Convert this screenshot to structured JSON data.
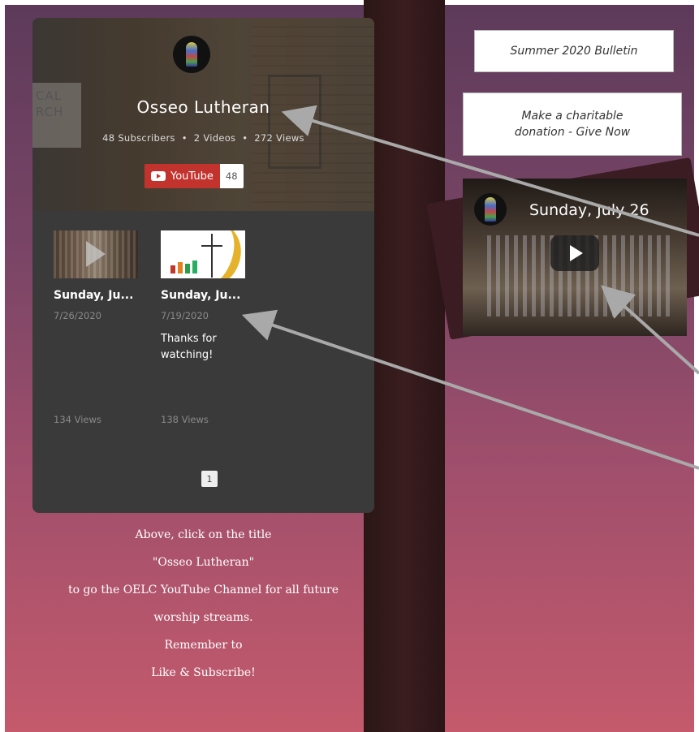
{
  "channel": {
    "title": "Osseo Lutheran",
    "stats": "48 Subscribers  •  2 Videos  •  272 Views",
    "youtube_label": "YouTube",
    "subscriber_count": "48",
    "sign_text_line1": "CAL",
    "sign_text_line2": "RCH"
  },
  "videos": [
    {
      "title": "Sunday, Ju...",
      "date": "7/26/2020",
      "description": "",
      "views": "134 Views"
    },
    {
      "title": "Sunday, Ju...",
      "date": "7/19/2020",
      "description": "Thanks for watching!",
      "views": "138 Views"
    }
  ],
  "pagination": {
    "current": "1"
  },
  "instructions": [
    "Above, click on the title",
    "\"Osseo Lutheran\"",
    "to go the OELC YouTube Channel for all future",
    "worship streams.",
    "Remember to",
    "Like & Subscribe!"
  ],
  "side_buttons": {
    "bulletin": "Summer 2020 Bulletin",
    "donate": "Make a charitable donation - Give Now"
  },
  "embed": {
    "title": "Sunday, July 26"
  },
  "colors": {
    "youtube_red": "#c3332e",
    "widget_bg": "#3a3a3a",
    "arrow": "#a9a9a9"
  }
}
